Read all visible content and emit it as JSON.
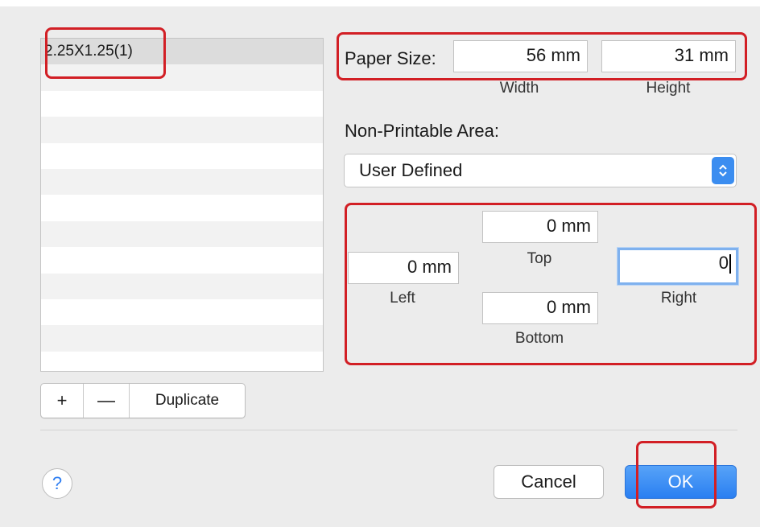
{
  "paper_list": {
    "items": [
      "2.25X1.25(1)"
    ],
    "selected_index": 0
  },
  "list_controls": {
    "add_label": "+",
    "remove_label": "—",
    "duplicate_label": "Duplicate"
  },
  "paper_size": {
    "label": "Paper Size:",
    "width_value": "56 mm",
    "width_caption": "Width",
    "height_value": "31 mm",
    "height_caption": "Height"
  },
  "non_printable": {
    "label": "Non-Printable Area:",
    "selected_option": "User Defined",
    "top_value": "0 mm",
    "top_caption": "Top",
    "left_value": "0 mm",
    "left_caption": "Left",
    "right_value": "0",
    "right_caption": "Right",
    "bottom_value": "0 mm",
    "bottom_caption": "Bottom"
  },
  "footer": {
    "help_label": "?",
    "cancel_label": "Cancel",
    "ok_label": "OK"
  },
  "icons": {
    "select_arrows": "up-down-chevron-icon",
    "help": "question-mark-icon"
  },
  "colors": {
    "accent": "#2a7ff1",
    "highlight_box": "#d21f25",
    "focus_ring": "#7fb1ee"
  }
}
